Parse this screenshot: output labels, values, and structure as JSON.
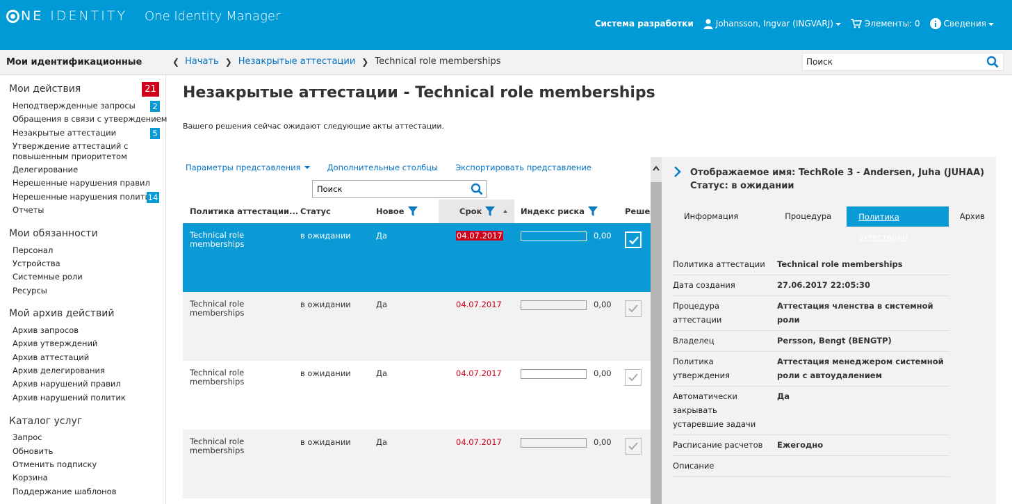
{
  "header": {
    "logo_word1": "NE",
    "logo_word2": "IDENTITY",
    "app_title": "One Identity Manager",
    "system": "Система разработки",
    "user": "Johansson, Ingvar (INGVARJ)",
    "cart": "Элементы: 0",
    "info": "Сведения"
  },
  "subbar": {
    "nav_heading": "Мои идентификационные",
    "breadcrumb": [
      "Начать",
      "Незакрытые аттестации",
      "Technical role memberships"
    ],
    "search_value": "Поиск"
  },
  "sidebar": {
    "groups": [
      {
        "title": "Мои действия",
        "badge": "21",
        "items": [
          {
            "label": "Неподтвержденные запросы",
            "badge": "2"
          },
          {
            "label": "Обращения в связи с утверждением",
            "badge": ""
          },
          {
            "label": "Незакрытые аттестации",
            "badge": "5"
          },
          {
            "label": "Утверждение аттестаций с повышенным приоритетом",
            "badge": ""
          },
          {
            "label": "Делегирование",
            "badge": ""
          },
          {
            "label": "Нерешенные нарушения правил",
            "badge": ""
          },
          {
            "label": "Нерешенные нарушения политик",
            "badge": "14"
          },
          {
            "label": "Отчеты",
            "badge": ""
          }
        ]
      },
      {
        "title": "Мои обязанности",
        "items": [
          {
            "label": "Персонал"
          },
          {
            "label": "Устройства"
          },
          {
            "label": "Системные роли"
          },
          {
            "label": "Ресурсы"
          }
        ]
      },
      {
        "title": "Мой архив действий",
        "items": [
          {
            "label": "Архив запросов"
          },
          {
            "label": "Архив утверждений"
          },
          {
            "label": "Архив аттестаций"
          },
          {
            "label": "Архив делегирования"
          },
          {
            "label": "Архив нарушений правил"
          },
          {
            "label": "Архив нарушений политик"
          }
        ]
      },
      {
        "title": "Каталог услуг",
        "items": [
          {
            "label": "Запрос"
          },
          {
            "label": "Обновить"
          },
          {
            "label": "Отменить подписку"
          },
          {
            "label": "Корзина"
          },
          {
            "label": "Поддержание шаблонов"
          }
        ]
      }
    ]
  },
  "main": {
    "title": "Незакрытые аттестации - Technical role memberships",
    "subtitle": "Вашего решения сейчас ожидают следующие акты аттестации.",
    "toolbar": {
      "view_params": "Параметры представления",
      "extra_columns": "Дополнительные столбцы",
      "export_view": "Экспортировать представление"
    },
    "grid_search_value": "Поиск",
    "columns": [
      "Политика аттестации...",
      "Статус",
      "Новое",
      "Срок",
      "Индекс риска",
      "Решен"
    ],
    "rows": [
      {
        "policy": "Technical role memberships",
        "status": "в ожидании",
        "new": "Да",
        "due": "04.07.2017",
        "risk": 0.0,
        "risk_text": "0,00",
        "checked": true,
        "selected": true
      },
      {
        "policy": "Technical role memberships",
        "status": "в ожидании",
        "new": "Да",
        "due": "04.07.2017",
        "risk": 0.0,
        "risk_text": "0,00",
        "checked": true,
        "selected": false
      },
      {
        "policy": "Technical role memberships",
        "status": "в ожидании",
        "new": "Да",
        "due": "04.07.2017",
        "risk": 0.0,
        "risk_text": "0,00",
        "checked": true,
        "selected": false
      },
      {
        "policy": "Technical role memberships",
        "status": "в ожидании",
        "new": "Да",
        "due": "04.07.2017",
        "risk": 0.0,
        "risk_text": "0,00",
        "checked": true,
        "selected": false
      }
    ]
  },
  "detail": {
    "display_name": "Отображаемое имя: TechRole 3 - Andersen, Juha (JUHAA)",
    "status": "Статус: в ожидании",
    "tabs": [
      "Информация",
      "Процедура",
      "Политика аттестации",
      "Архив"
    ],
    "active_tab": "Политика аттестации",
    "properties": [
      {
        "key": "Политика аттестации",
        "value": "Technical role memberships"
      },
      {
        "key": "Дата создания",
        "value": "27.06.2017 22:05:30"
      },
      {
        "key": "Процедура аттестации",
        "value": "Аттестация членства в системной роли"
      },
      {
        "key": "Владелец",
        "value": "Persson, Bengt (BENGTP)"
      },
      {
        "key": "Политика утверждения",
        "value": "Аттестация менеджером системной роли с автоудалением"
      },
      {
        "key": "Автоматически закрывать устаревшие задачи",
        "value": "Да"
      },
      {
        "key": "Расписание расчетов",
        "value": "Ежегодно"
      },
      {
        "key": "Описание",
        "value": ""
      }
    ]
  },
  "colors": {
    "brand": "#009ad6",
    "accent": "#0a9ad6",
    "alert": "#d0021b",
    "link": "#0072c6"
  }
}
